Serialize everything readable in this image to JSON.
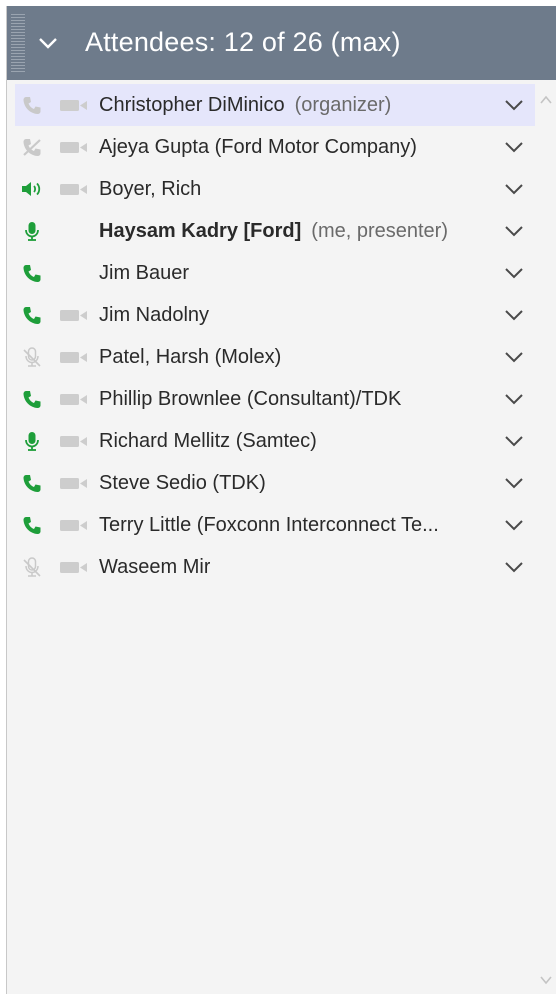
{
  "header": {
    "title": "Attendees:  12 of 26 (max)",
    "collapse_icon": "chevron-down-icon"
  },
  "colors": {
    "header_bg": "#6e7b8b",
    "panel_bg": "#f4f4f4",
    "selected_row_bg": "#e5e6fb",
    "active_green": "#1e9e3a",
    "inactive_gray": "#c9c9c9"
  },
  "attendees": [
    {
      "name": "Christopher DiMinico",
      "role": "(organizer)",
      "bold": false,
      "audio": "phone-inactive",
      "video": "camera-off",
      "selected": true
    },
    {
      "name": "Ajeya Gupta (Ford Motor Company)",
      "role": "",
      "bold": false,
      "audio": "phone-muted",
      "video": "camera-off",
      "selected": false
    },
    {
      "name": "Boyer, Rich",
      "role": "",
      "bold": false,
      "audio": "speaker-active",
      "video": "camera-off",
      "selected": false
    },
    {
      "name": "Haysam Kadry [Ford]",
      "role": "(me, presenter)",
      "bold": true,
      "audio": "mic-active",
      "video": "none",
      "selected": false
    },
    {
      "name": "Jim Bauer",
      "role": "",
      "bold": false,
      "audio": "phone-active",
      "video": "none",
      "selected": false
    },
    {
      "name": "Jim Nadolny",
      "role": "",
      "bold": false,
      "audio": "phone-active",
      "video": "camera-off",
      "selected": false
    },
    {
      "name": "Patel, Harsh (Molex)",
      "role": "",
      "bold": false,
      "audio": "mic-muted",
      "video": "camera-off",
      "selected": false
    },
    {
      "name": "Phillip Brownlee (Consultant)/TDK",
      "role": "",
      "bold": false,
      "audio": "phone-active",
      "video": "camera-off",
      "selected": false
    },
    {
      "name": "Richard Mellitz (Samtec)",
      "role": "",
      "bold": false,
      "audio": "mic-active",
      "video": "camera-off",
      "selected": false
    },
    {
      "name": "Steve Sedio (TDK)",
      "role": "",
      "bold": false,
      "audio": "phone-active",
      "video": "camera-off",
      "selected": false
    },
    {
      "name": "Terry Little (Foxconn Interconnect Te...",
      "role": "",
      "bold": false,
      "audio": "phone-active",
      "video": "camera-off",
      "selected": false
    },
    {
      "name": "Waseem Mir",
      "role": "",
      "bold": false,
      "audio": "mic-muted",
      "video": "camera-off",
      "selected": false
    }
  ]
}
